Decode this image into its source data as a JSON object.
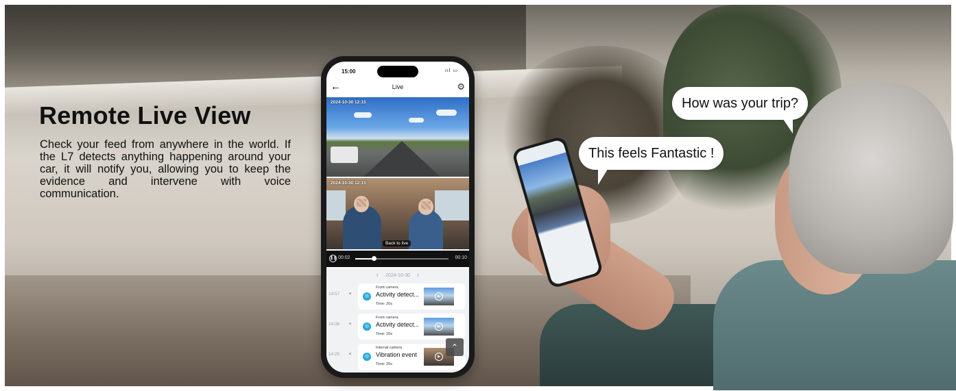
{
  "promo": {
    "headline": "Remote Live View",
    "description": "Check your feed from anywhere in the world. If the L7 detects anything happening around your car, it will notify you, allowing you to keep the evidence and intervene with voice communication."
  },
  "phone": {
    "status_time": "15:00",
    "status_icons": "ııl ▭",
    "header_title": "Live",
    "front_timestamp": "2024-10-30 12:15",
    "cabin_timestamp": "2024-10-30 12:15",
    "back_to_live_label": "Back to live",
    "player": {
      "current_time": "00:02",
      "duration": "00:10",
      "progress": 0.2
    },
    "date_nav": {
      "prev": "‹",
      "date": "2024-10-30",
      "next": "›"
    },
    "events": [
      {
        "time": "14:57",
        "camera": "Front camera",
        "title": "Activity detect...",
        "duration": "Time: 20s"
      },
      {
        "time": "14:36",
        "camera": "Front camera",
        "title": "Activity detect...",
        "duration": "Time: 20s"
      },
      {
        "time": "14:25",
        "camera": "Internal camera",
        "title": "Vibration event",
        "duration": "Time: 20s"
      }
    ]
  },
  "bubbles": {
    "question": "How was your trip?",
    "answer": "This feels Fantastic !"
  },
  "icons": {
    "back": "arrow-left-icon",
    "settings": "gear-icon",
    "pause": "pause-icon",
    "event": "camera-event-icon",
    "play": "play-icon",
    "scroll_top": "chevron-up-icon"
  },
  "colors": {
    "accent": "#29a8d8",
    "headline_text": "#111111"
  }
}
